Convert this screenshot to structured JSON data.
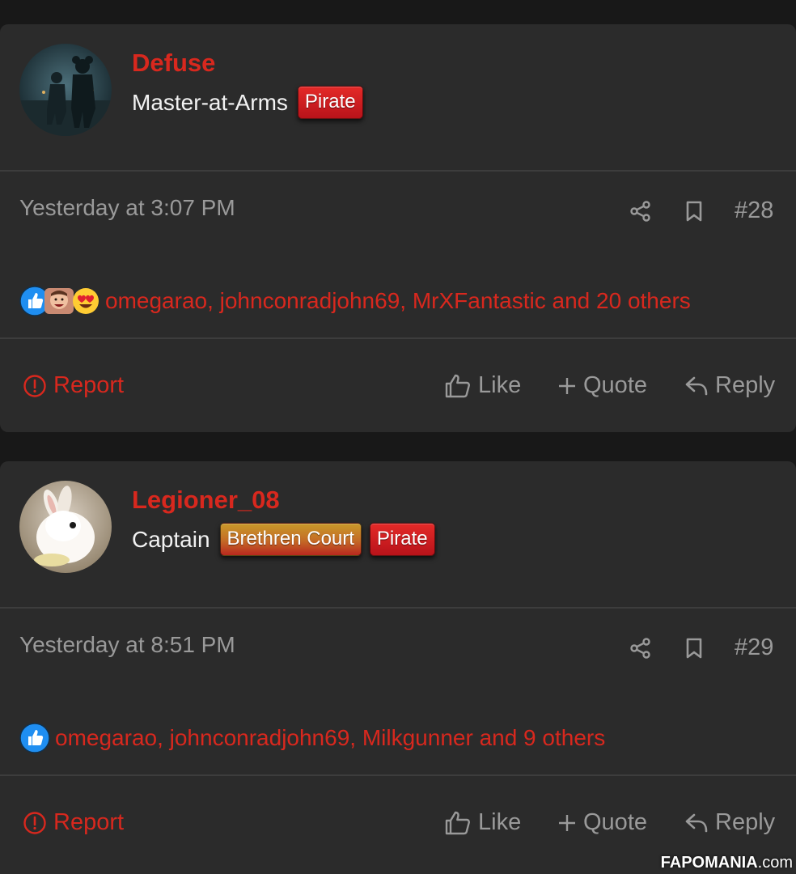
{
  "posts": [
    {
      "username": "Defuse",
      "user_title": "Master-at-Arms",
      "badges": [
        "Pirate"
      ],
      "timestamp": "Yesterday at 3:07 PM",
      "post_number": "#28",
      "reactions": [
        "like",
        "haha",
        "love"
      ],
      "reactors_text": "omegarao, johnconradjohn69, MrXFantastic and 20 others",
      "actions": {
        "report": "Report",
        "like": "Like",
        "quote": "Quote",
        "reply": "Reply"
      }
    },
    {
      "username": "Legioner_08",
      "user_title": "Captain",
      "badges": [
        "Brethren Court",
        "Pirate"
      ],
      "timestamp": "Yesterday at 8:51 PM",
      "post_number": "#29",
      "reactions": [
        "like"
      ],
      "reactors_text": "omegarao, johnconradjohn69, Milkgunner and 9 others",
      "actions": {
        "report": "Report",
        "like": "Like",
        "quote": "Quote",
        "reply": "Reply"
      }
    }
  ],
  "watermark": {
    "brand": "FAPOMANIA",
    "tld": ".com"
  },
  "colors": {
    "accent": "#d8281e",
    "muted_text": "#9a9a9a",
    "card_bg": "#2b2b2b",
    "page_bg": "#181818",
    "like_blue": "#1f8ef1"
  },
  "icons": {
    "share": "share-icon",
    "bookmark": "bookmark-icon",
    "report": "alert-circle-icon",
    "like": "thumbs-up-icon",
    "quote": "plus-icon",
    "reply": "reply-icon"
  }
}
